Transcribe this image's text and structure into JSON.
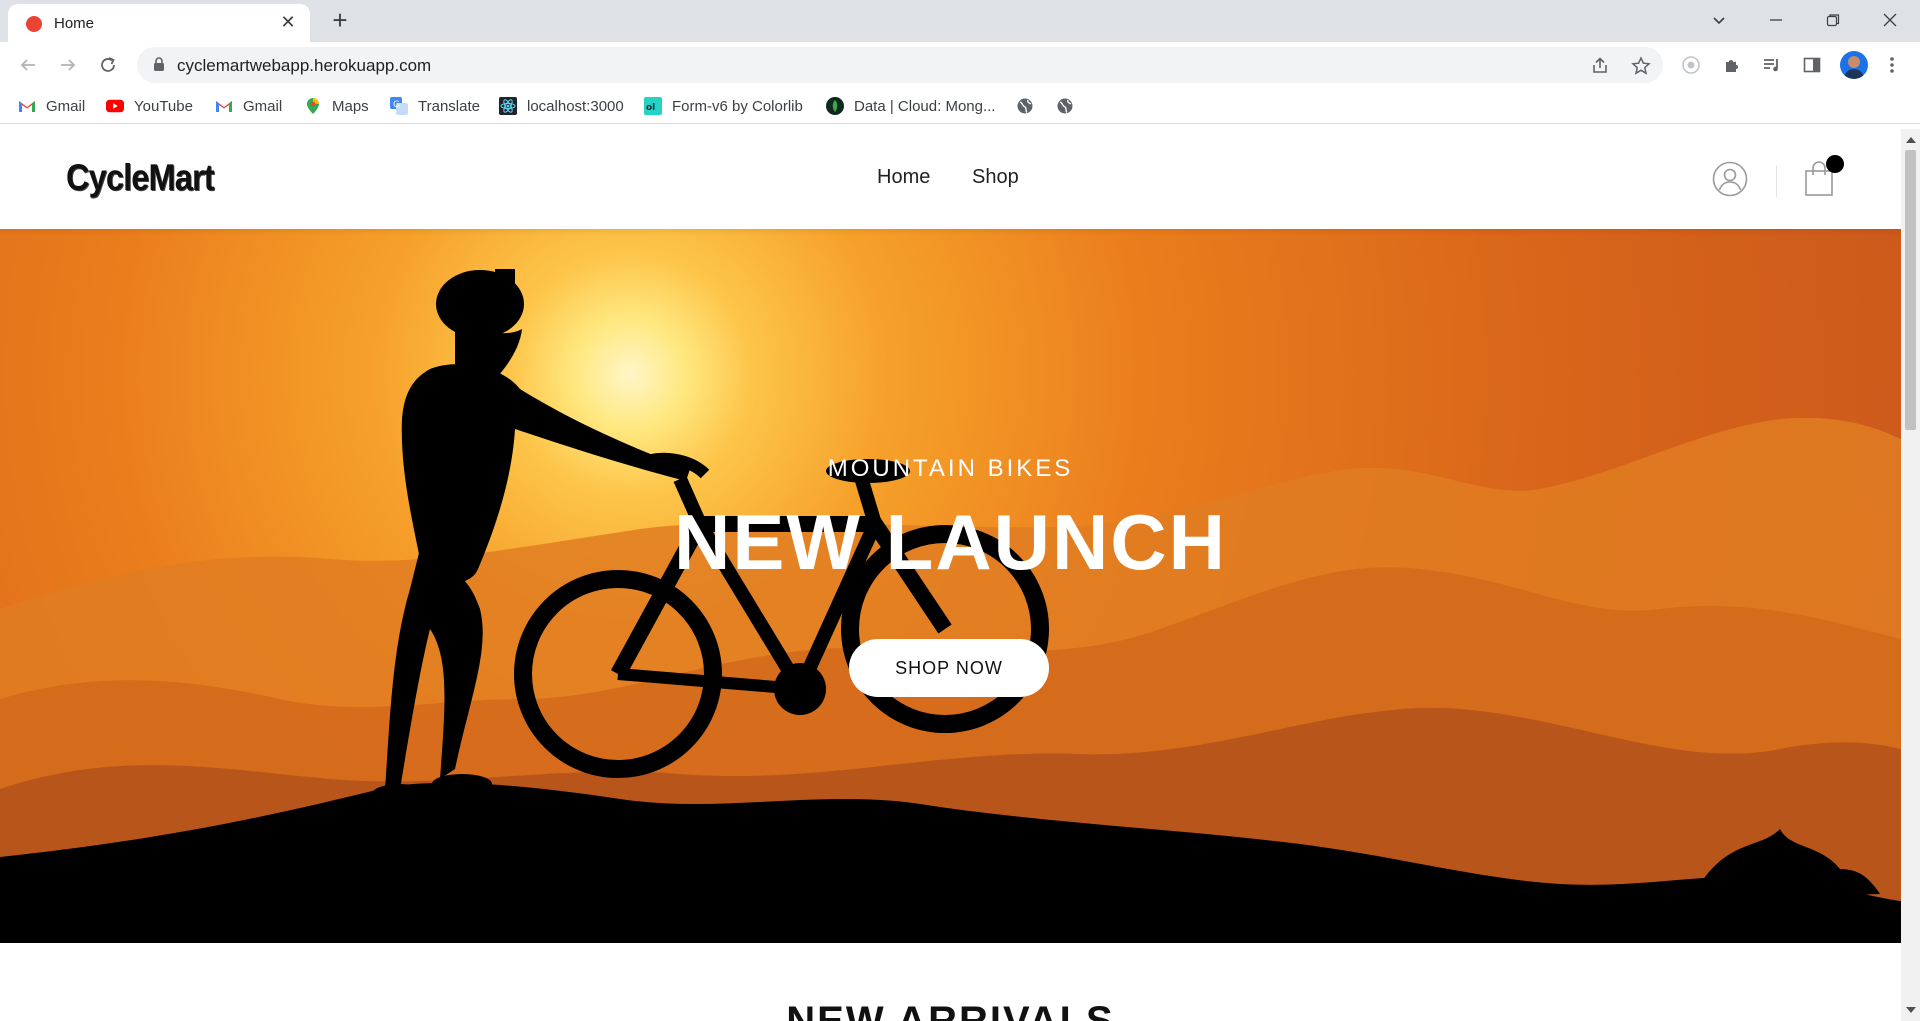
{
  "browser": {
    "tab_title": "Home",
    "url": "cyclemartwebapp.herokuapp.com",
    "tab_close_glyph": "✕",
    "new_tab_glyph": "+",
    "bookmarks": [
      {
        "label": "Gmail",
        "icon": "gmail-icon"
      },
      {
        "label": "YouTube",
        "icon": "youtube-icon"
      },
      {
        "label": "Gmail",
        "icon": "gmail-icon"
      },
      {
        "label": "Maps",
        "icon": "maps-icon"
      },
      {
        "label": "Translate",
        "icon": "translate-icon"
      },
      {
        "label": "localhost:3000",
        "icon": "react-icon"
      },
      {
        "label": "Form-v6 by Colorlib",
        "icon": "colorlib-icon"
      },
      {
        "label": "Data | Cloud: Mong...",
        "icon": "mongodb-icon"
      },
      {
        "label": "",
        "icon": "globe-icon"
      },
      {
        "label": "",
        "icon": "globe-icon"
      }
    ]
  },
  "site": {
    "logo": "CycleMart",
    "nav": {
      "home": "Home",
      "shop": "Shop"
    },
    "hero": {
      "subtitle": "MOUNTAIN BIKES",
      "title": "NEW LAUNCH",
      "cta": "SHOP NOW"
    },
    "section_title": "NEW ARRIVALS"
  },
  "colors": {
    "tab_favicon": "#ea4335",
    "hero_sky": "#f6a02a",
    "silhouette": "#000000"
  }
}
